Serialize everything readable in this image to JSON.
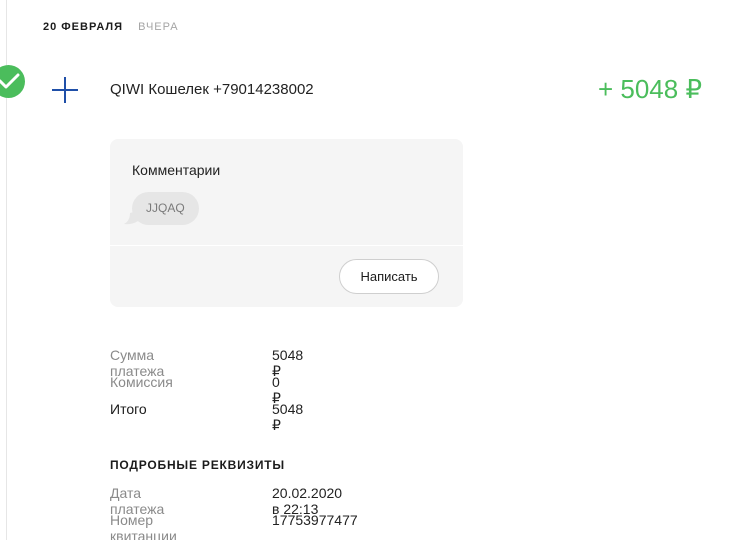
{
  "date_tabs": {
    "active": "20 февраля",
    "inactive": "Вчера"
  },
  "transaction": {
    "title": "QIWI Кошелек +79014238002",
    "amount": "+ 5048 ₽",
    "status_icon": "check-icon",
    "type_icon": "plus-icon",
    "accent_color": "#4bbd5c"
  },
  "comments": {
    "title": "Комментарии",
    "bubble_text": "JJQAQ",
    "write_button": "Написать"
  },
  "summary": {
    "rows": [
      {
        "label": "Сумма платежа",
        "value": "5048 ₽"
      },
      {
        "label": "Комиссия",
        "value": "0 ₽"
      },
      {
        "label": "Итого",
        "value": "5048 ₽"
      }
    ]
  },
  "details": {
    "title": "Подробные реквизиты",
    "rows": [
      {
        "label": "Дата платежа",
        "value": "20.02.2020 в 22:13"
      },
      {
        "label": "Номер квитанции",
        "value": "17753977477"
      }
    ]
  }
}
